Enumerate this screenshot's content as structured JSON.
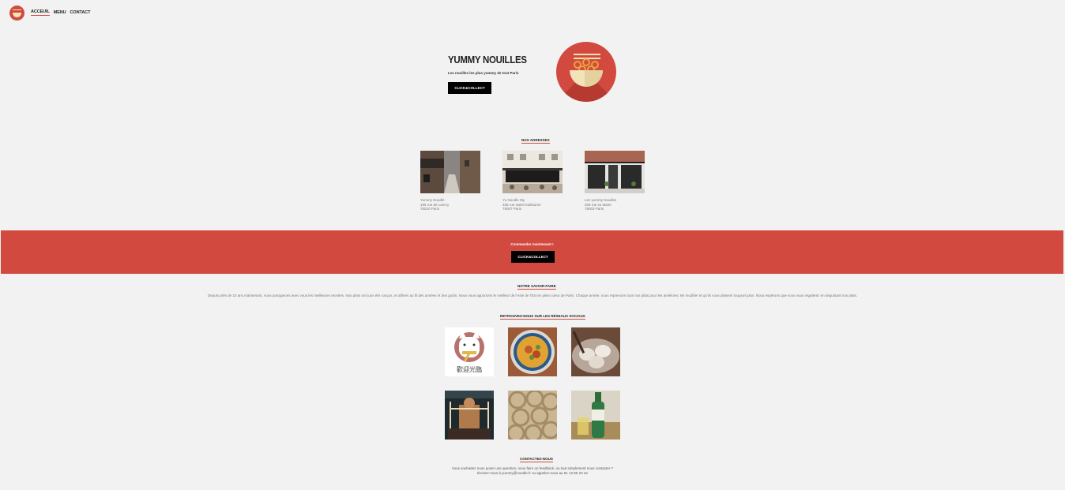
{
  "nav": {
    "items": [
      {
        "label": "Acceuil"
      },
      {
        "label": "Menu"
      },
      {
        "label": "Contact"
      }
    ]
  },
  "hero": {
    "title": "Yummy Nouilles",
    "subtitle": "Les nouilles les plus yummy de tout Paris",
    "button": "Click&Collect"
  },
  "addresses": {
    "title": "Nos adresses",
    "items": [
      {
        "name": "Yummy Noodle",
        "street": "185 rue de Lancry",
        "city": "75010 Paris"
      },
      {
        "name": "Yu Noodle My",
        "street": "335 rue Saint-Guillaume",
        "city": "75007 Paris"
      },
      {
        "name": "Les yummy Nouilles",
        "street": "206 rue su Maire",
        "city": "75003 Paris"
      }
    ]
  },
  "banner": {
    "text": "Commander maintenant !",
    "button": "Click&Collect"
  },
  "savoir": {
    "title": "Notre savoir-faire",
    "text": "Depuis près de 10 ans maintenant, nous partageons avec vous les meilleures recettes. Nos plats ont tous été conçus, et affinés au fil des années et des goûts. Nous vous apportons le meilleur de l'Asie de l'Est en plein coeur de Paris. Chaque année, nous reprenons tous nos plats pour les améliorer, les modifier et qu'ils vous plaisent toujours plus. Nous espérons que vous vous régalerez en dégustant nos plats."
  },
  "social": {
    "title": "Retrouvez-nous sur les réseaux sociaux",
    "lucky_cat_caption": "歡迎光臨"
  },
  "contact": {
    "title": "Contactez-nous",
    "line1": "Vous souhaitez nous poser une question, nous faire un feedback, ou tout simplement nous contacter ?",
    "line2": "Écrivez-nous à yummy@noodle.fr ou appelez-nous au 01 13 86 23 42"
  },
  "colors": {
    "accent": "#d24a3f",
    "background": "#f2f2f2",
    "button": "#000000"
  }
}
